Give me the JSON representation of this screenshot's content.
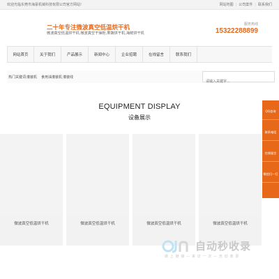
{
  "topbar": {
    "welcome": "欢迎光临东莞市海豪机械科技有限公司官方网站!",
    "links": [
      "网站地图",
      "公司案件",
      "联系我们"
    ]
  },
  "header": {
    "slogan": "二十年专注微波真空低温烘干机",
    "subtitle": "微波真空低温烘干机,微波真空干燥柜,果蔬烘干机,海鲜烘干机",
    "hotline_label": "服务热线",
    "hotline_number": "15322288899"
  },
  "nav": {
    "items": [
      "网站首页",
      "关于我们",
      "产品展示",
      "新闻中心",
      "企业招聘",
      "在线留言",
      "联系我们"
    ]
  },
  "hotwords": {
    "label": "热门关键词:",
    "items": [
      "灌装机",
      "食用油灌装机",
      "灌装线"
    ]
  },
  "search": {
    "placeholder": "请输入关键字..."
  },
  "section": {
    "title": "EQUIPMENT DISPLAY",
    "subtitle": "设备展示"
  },
  "products": [
    {
      "caption": "微波真空低温烘干机"
    },
    {
      "caption": "微波真空低温烘干机"
    },
    {
      "caption": "微波真空低温烘干机"
    },
    {
      "caption": "微波真空低温烘干机"
    }
  ],
  "side_panel": {
    "items": [
      "QQ咨询",
      "联系电话",
      "在线留言",
      "微信扫一扫"
    ],
    "color": "#e8681a"
  },
  "watermark": {
    "main": "自动秒收录",
    "sub": "做 上 链 接 — 来 访 一 次 — 自 动 收 录"
  },
  "colors": {
    "accent": "#e8681a"
  }
}
